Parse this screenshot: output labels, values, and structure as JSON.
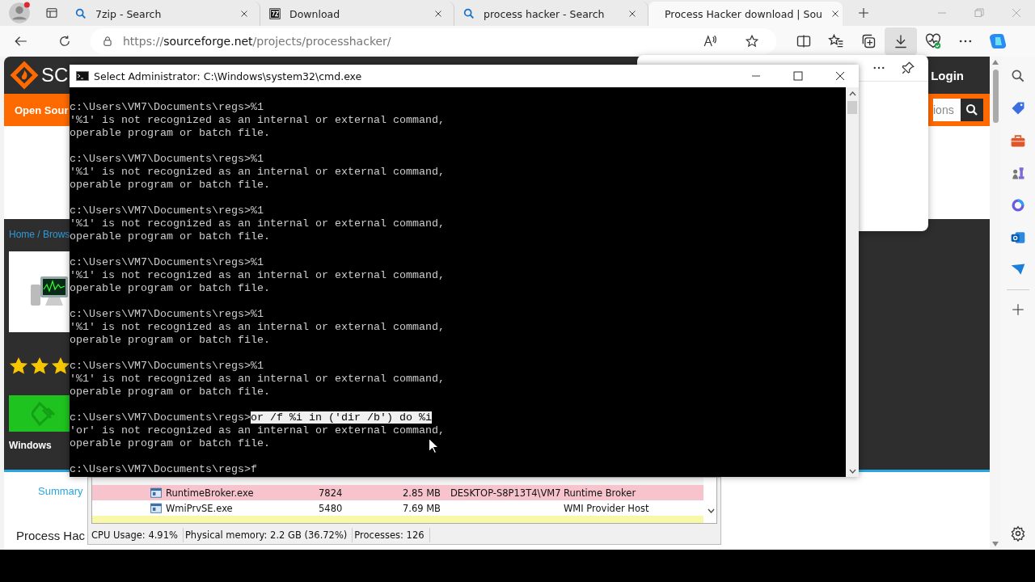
{
  "browser": {
    "tabs": [
      {
        "title": "7zip - Search",
        "kind": "search",
        "selected": false
      },
      {
        "title": "Download",
        "kind": "archive",
        "selected": false
      },
      {
        "title": "process hacker - Search",
        "kind": "search",
        "selected": false
      },
      {
        "title": "Process Hacker download | Sou",
        "kind": "site",
        "selected": true
      }
    ],
    "address": {
      "scheme": "https://",
      "host": "sourceforge.net",
      "path": "/projects/processhacker/"
    },
    "downloads_open": true
  },
  "page": {
    "logo_text": "SC",
    "login": "Login",
    "nav_label": "Open Sour",
    "search_placeholder": "ions",
    "breadcrumb": "Home / Brows",
    "stars": 3,
    "platform": "Windows",
    "summary_tab": "Summary",
    "project_title": "Process Hac"
  },
  "cmd": {
    "title": "Select Administrator: C:\\Windows\\system32\\cmd.exe",
    "lines": [
      {
        "kind": "prompt",
        "prompt": "c:\\Users\\VM7\\Documents\\regs>",
        "command": "%1",
        "selected": false
      },
      {
        "kind": "output",
        "text": "'%1' is not recognized as an internal or external command,"
      },
      {
        "kind": "output",
        "text": "operable program or batch file."
      },
      {
        "kind": "blank"
      },
      {
        "kind": "prompt",
        "prompt": "c:\\Users\\VM7\\Documents\\regs>",
        "command": "%1",
        "selected": false
      },
      {
        "kind": "output",
        "text": "'%1' is not recognized as an internal or external command,"
      },
      {
        "kind": "output",
        "text": "operable program or batch file."
      },
      {
        "kind": "blank"
      },
      {
        "kind": "prompt",
        "prompt": "c:\\Users\\VM7\\Documents\\regs>",
        "command": "%1",
        "selected": false
      },
      {
        "kind": "output",
        "text": "'%1' is not recognized as an internal or external command,"
      },
      {
        "kind": "output",
        "text": "operable program or batch file."
      },
      {
        "kind": "blank"
      },
      {
        "kind": "prompt",
        "prompt": "c:\\Users\\VM7\\Documents\\regs>",
        "command": "%1",
        "selected": false
      },
      {
        "kind": "output",
        "text": "'%1' is not recognized as an internal or external command,"
      },
      {
        "kind": "output",
        "text": "operable program or batch file."
      },
      {
        "kind": "blank"
      },
      {
        "kind": "prompt",
        "prompt": "c:\\Users\\VM7\\Documents\\regs>",
        "command": "%1",
        "selected": false
      },
      {
        "kind": "output",
        "text": "'%1' is not recognized as an internal or external command,"
      },
      {
        "kind": "output",
        "text": "operable program or batch file."
      },
      {
        "kind": "blank"
      },
      {
        "kind": "prompt",
        "prompt": "c:\\Users\\VM7\\Documents\\regs>",
        "command": "%1",
        "selected": false
      },
      {
        "kind": "output",
        "text": "'%1' is not recognized as an internal or external command,"
      },
      {
        "kind": "output",
        "text": "operable program or batch file."
      },
      {
        "kind": "blank"
      },
      {
        "kind": "prompt",
        "prompt": "c:\\Users\\VM7\\Documents\\regs>",
        "command": "or /f %i in ('dir /b') do %i",
        "selected": true
      },
      {
        "kind": "output",
        "text": "'or' is not recognized as an internal or external command,"
      },
      {
        "kind": "output",
        "text": "operable program or batch file."
      },
      {
        "kind": "blank"
      },
      {
        "kind": "prompt",
        "prompt": "c:\\Users\\VM7\\Documents\\regs>",
        "command": "f",
        "selected": false
      }
    ]
  },
  "process_hacker": {
    "rows": [
      {
        "kind": "partial",
        "color": "#f4f4f4"
      },
      {
        "kind": "process",
        "name": "RuntimeBroker.exe",
        "pid": "7824",
        "memory": "2.85 MB",
        "user": "DESKTOP-S8P13T4\\VM7",
        "description": "Runtime Broker",
        "color": "#f7c3cc"
      },
      {
        "kind": "process",
        "name": "WmiPrvSE.exe",
        "pid": "5480",
        "memory": "7.69 MB",
        "description": "WMI Provider Host",
        "color": "#ffffff"
      },
      {
        "kind": "partial",
        "color": "#f9f7a8"
      }
    ],
    "status": [
      "CPU Usage: 4.91%",
      "Physical memory: 2.2 GB (36.72%)",
      "Processes: 126"
    ]
  }
}
